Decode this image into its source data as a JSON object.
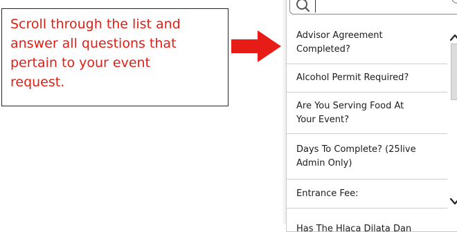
{
  "callout": {
    "text": "Scroll through the list and\nanswer all questions that\npertain to your event\nrequest."
  },
  "colors": {
    "callout_text": "#e11d14",
    "arrow": "#e81c16",
    "panel_border": "#c9c9c9",
    "divider": "#cfcfcf"
  },
  "search": {
    "icon": "search-icon",
    "value": ""
  },
  "list": {
    "items": [
      {
        "label": "Advisor Agreement\nCompleted?"
      },
      {
        "label": "Alcohol Permit Required?"
      },
      {
        "label": "Are You Serving Food At\nYour Event?"
      },
      {
        "label": "Days To Complete? (25live\nAdmin Only)"
      },
      {
        "label": "Entrance Fee:"
      },
      {
        "label": "Has The Hlaca Dilata Dan"
      }
    ]
  },
  "scrollbar": {
    "up_icon": "chevron-up-icon",
    "down_icon": "chevron-down-icon"
  }
}
